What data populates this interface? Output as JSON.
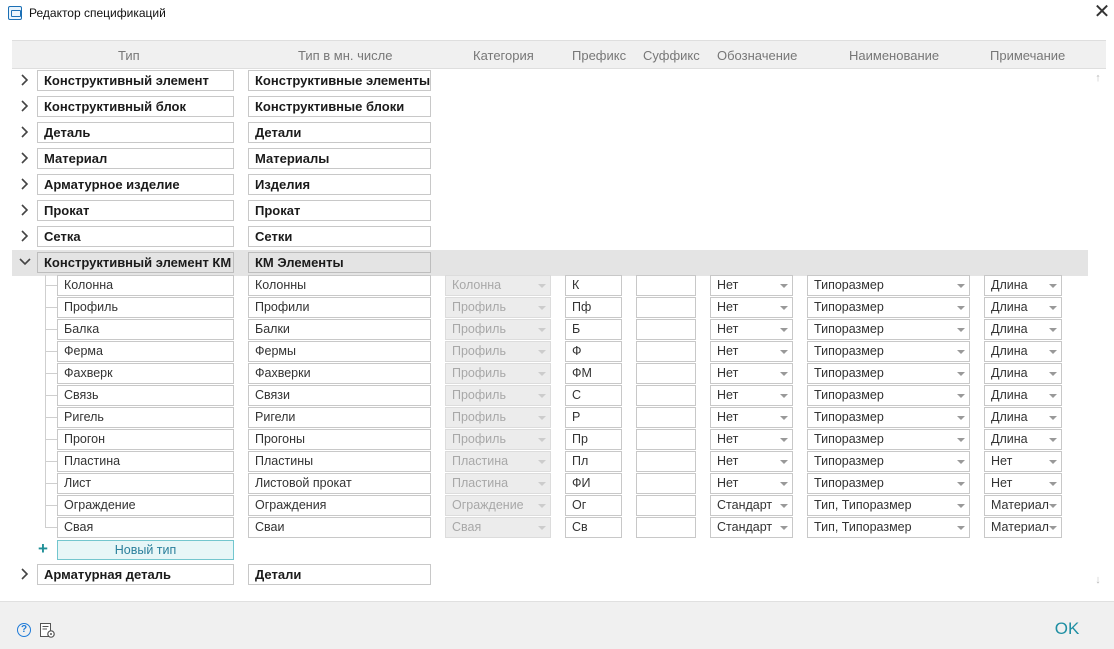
{
  "window": {
    "title": "Редактор спецификаций",
    "close_icon": "✕"
  },
  "columns": {
    "type": "Тип",
    "plural": "Тип в мн. числе",
    "category": "Категория",
    "prefix": "Префикс",
    "suffix": "Суффикс",
    "designation": "Обозначение",
    "name": "Наименование",
    "note": "Примечание"
  },
  "top_groups": [
    {
      "type": "Конструктивный элемент",
      "plural": "Конструктивные элементы"
    },
    {
      "type": "Конструктивный блок",
      "plural": "Конструктивные блоки"
    },
    {
      "type": "Деталь",
      "plural": "Детали"
    },
    {
      "type": "Материал",
      "plural": "Материалы"
    },
    {
      "type": "Арматурное изделие",
      "plural": "Изделия"
    },
    {
      "type": "Прокат",
      "plural": "Прокат"
    },
    {
      "type": "Сетка",
      "plural": "Сетки"
    }
  ],
  "expanded_group": {
    "type": "Конструктивный элемент КМ",
    "plural": "КМ Элементы"
  },
  "children": [
    {
      "type": "Колонна",
      "plural": "Колонны",
      "category": "Колонна",
      "prefix": "К",
      "suffix": "",
      "designation": "Нет",
      "name": "Типоразмер",
      "note": "Длина"
    },
    {
      "type": "Профиль",
      "plural": "Профили",
      "category": "Профиль",
      "prefix": "Пф",
      "suffix": "",
      "designation": "Нет",
      "name": "Типоразмер",
      "note": "Длина"
    },
    {
      "type": "Балка",
      "plural": "Балки",
      "category": "Профиль",
      "prefix": "Б",
      "suffix": "",
      "designation": "Нет",
      "name": "Типоразмер",
      "note": "Длина"
    },
    {
      "type": "Ферма",
      "plural": "Фермы",
      "category": "Профиль",
      "prefix": "Ф",
      "suffix": "",
      "designation": "Нет",
      "name": "Типоразмер",
      "note": "Длина"
    },
    {
      "type": "Фахверк",
      "plural": "Фахверки",
      "category": "Профиль",
      "prefix": "ФМ",
      "suffix": "",
      "designation": "Нет",
      "name": "Типоразмер",
      "note": "Длина"
    },
    {
      "type": "Связь",
      "plural": "Связи",
      "category": "Профиль",
      "prefix": "С",
      "suffix": "",
      "designation": "Нет",
      "name": "Типоразмер",
      "note": "Длина"
    },
    {
      "type": "Ригель",
      "plural": "Ригели",
      "category": "Профиль",
      "prefix": "Р",
      "suffix": "",
      "designation": "Нет",
      "name": "Типоразмер",
      "note": "Длина"
    },
    {
      "type": "Прогон",
      "plural": "Прогоны",
      "category": "Профиль",
      "prefix": "Пр",
      "suffix": "",
      "designation": "Нет",
      "name": "Типоразмер",
      "note": "Длина"
    },
    {
      "type": "Пластина",
      "plural": "Пластины",
      "category": "Пластина",
      "prefix": "Пл",
      "suffix": "",
      "designation": "Нет",
      "name": "Типоразмер",
      "note": "Нет"
    },
    {
      "type": "Лист",
      "plural": "Листовой прокат",
      "category": "Пластина",
      "prefix": "ФИ",
      "suffix": "",
      "designation": "Нет",
      "name": "Типоразмер",
      "note": "Нет"
    },
    {
      "type": "Ограждение",
      "plural": "Ограждения",
      "category": "Ограждение",
      "prefix": "Ог",
      "suffix": "",
      "designation": "Стандарт",
      "name": "Тип, Типоразмер",
      "note": "Материал"
    },
    {
      "type": "Свая",
      "plural": "Сваи",
      "category": "Свая",
      "prefix": "Св",
      "suffix": "",
      "designation": "Стандарт",
      "name": "Тип, Типоразмер",
      "note": "Материал"
    }
  ],
  "new_type": {
    "plus": "+",
    "label": "Новый тип"
  },
  "bottom_group": {
    "type": "Арматурная деталь",
    "plural": "Детали"
  },
  "scrollbar": {
    "up_icon": "↑",
    "down_icon": "↓"
  },
  "footer": {
    "help_icon": "?",
    "ok_label": "OK"
  },
  "colors": {
    "accent": "#1f8fa3",
    "new_type_border": "#73c6ce",
    "selected_row": "#e4e4e4",
    "header_bg": "#f0f0f0"
  }
}
